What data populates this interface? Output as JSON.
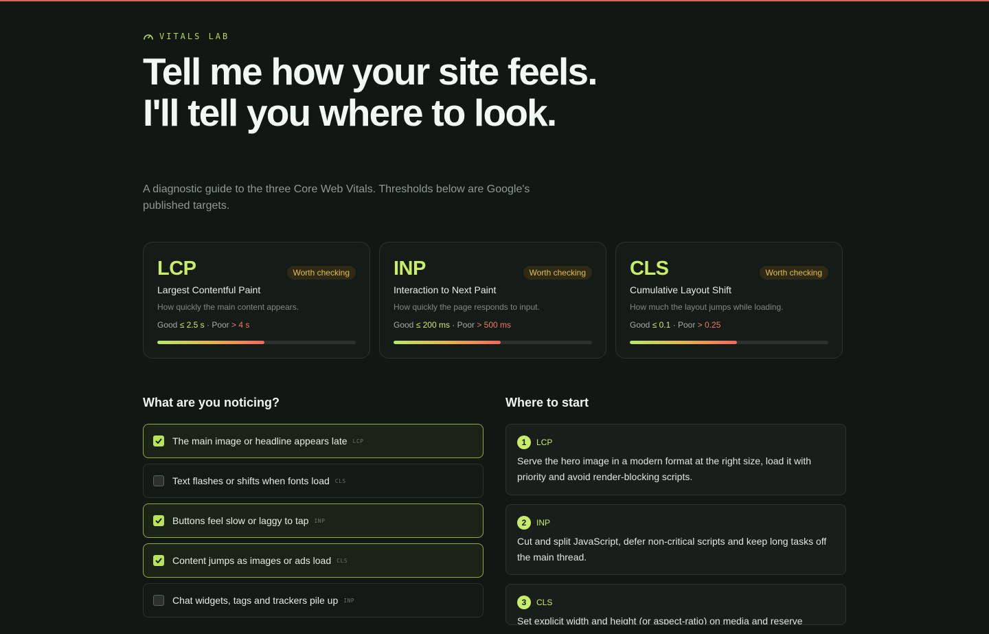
{
  "brand": {
    "eyebrow": "VITALS LAB",
    "icon": "gauge-icon",
    "accent": "#c9ec6a",
    "top_line": "#d9695a"
  },
  "hero": {
    "title": "Tell me how your site feels. I'll tell you where to look.",
    "subtitle": "A diagnostic guide to the three Core Web Vitals. Thresholds below are Google's published targets."
  },
  "cards": [
    {
      "abbr": "LCP",
      "name": "Largest Contentful Paint",
      "badge": "Worth checking",
      "desc": "How quickly the main content appears.",
      "good_label": "Good ",
      "good_val": "≤ 2.5 s",
      "sep": " · ",
      "poor_label": "Poor ",
      "poor_val": "> 4 s",
      "level": 0.54
    },
    {
      "abbr": "INP",
      "name": "Interaction to Next Paint",
      "badge": "Worth checking",
      "desc": "How quickly the page responds to input.",
      "good_label": "Good ",
      "good_val": "≤ 200 ms",
      "sep": " · ",
      "poor_label": "Poor ",
      "poor_val": "> 500 ms",
      "level": 0.54
    },
    {
      "abbr": "CLS",
      "name": "Cumulative Layout Shift",
      "badge": "Worth checking",
      "desc": "How much the layout jumps while loading.",
      "good_label": "Good ",
      "good_val": "≤ 0.1",
      "sep": " · ",
      "poor_label": "Poor ",
      "poor_val": "> 0.25",
      "level": 0.54
    }
  ],
  "symptoms": {
    "title": "What are you noticing?",
    "items": [
      {
        "text": "The main image or headline appears late",
        "tag": "LCP",
        "checked": true
      },
      {
        "text": "Text flashes or shifts when fonts load",
        "tag": "CLS",
        "checked": false
      },
      {
        "text": "Buttons feel slow or laggy to tap",
        "tag": "INP",
        "checked": true
      },
      {
        "text": "Content jumps as images or ads load",
        "tag": "CLS",
        "checked": true
      },
      {
        "text": "Chat widgets, tags and trackers pile up",
        "tag": "INP",
        "checked": false
      }
    ]
  },
  "recs": {
    "title": "Where to start",
    "items": [
      {
        "num": "1",
        "metric": "LCP",
        "text": "Serve the hero image in a modern format at the right size, load it with priority and avoid render-blocking scripts."
      },
      {
        "num": "2",
        "metric": "INP",
        "text": "Cut and split JavaScript, defer non-critical scripts and keep long tasks off the main thread."
      },
      {
        "num": "3",
        "metric": "CLS",
        "text": "Set explicit width and height (or aspect-ratio) on media and reserve"
      }
    ]
  }
}
